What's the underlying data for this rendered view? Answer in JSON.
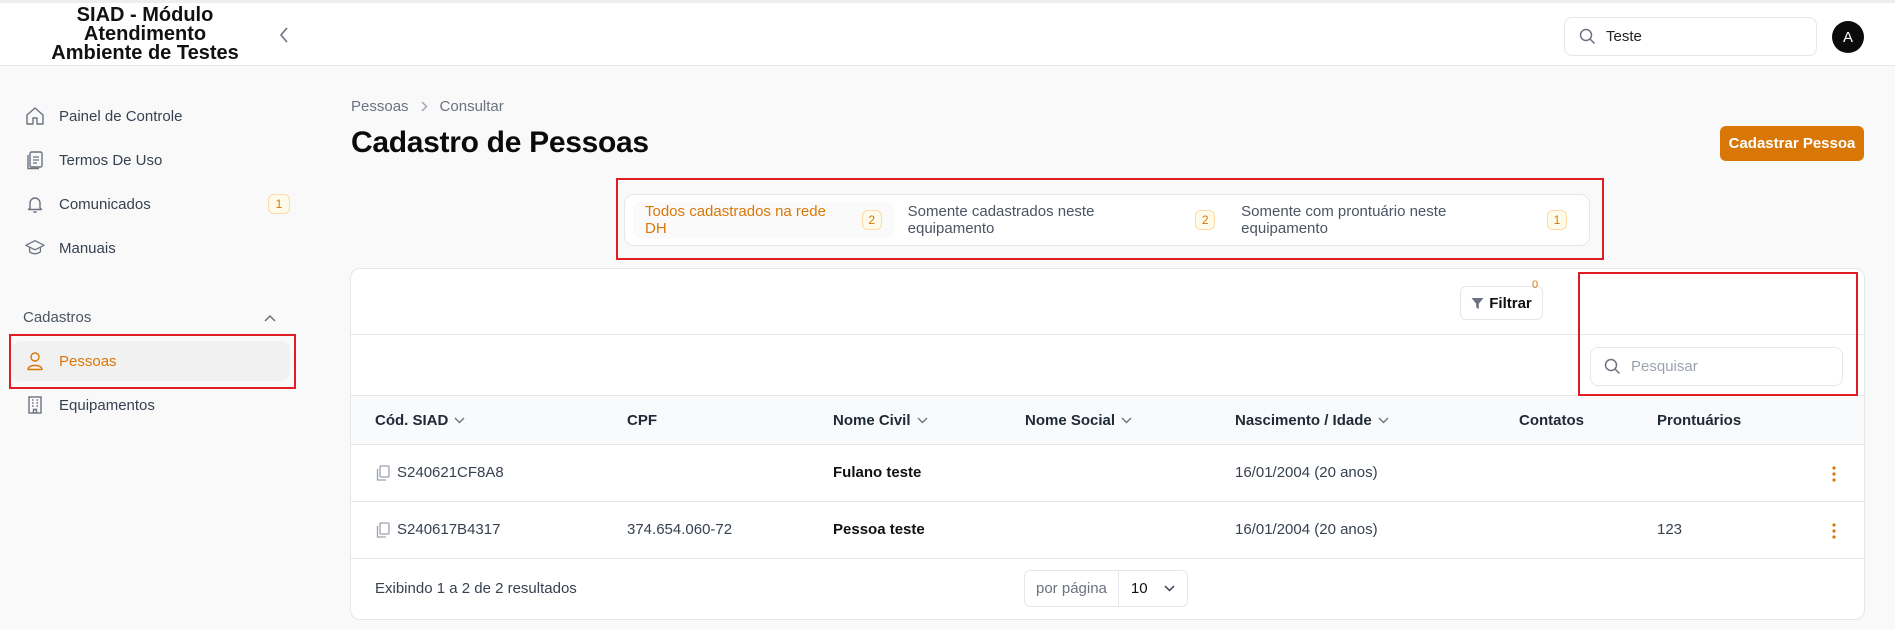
{
  "header": {
    "app_title": "SIAD - Módulo Atendimento Ambiente de Testes",
    "search_value": "Teste",
    "avatar_initial": "A"
  },
  "sidebar": {
    "items": [
      {
        "label": "Painel de Controle",
        "icon": "home-icon"
      },
      {
        "label": "Termos De Uso",
        "icon": "document-icon"
      },
      {
        "label": "Comunicados",
        "icon": "bell-icon",
        "badge": "1"
      },
      {
        "label": "Manuais",
        "icon": "graduation-cap-icon"
      }
    ],
    "section_label": "Cadastros",
    "section_items": [
      {
        "label": "Pessoas",
        "icon": "user-icon",
        "active": true
      },
      {
        "label": "Equipamentos",
        "icon": "building-icon"
      }
    ]
  },
  "breadcrumb": [
    "Pessoas",
    "Consultar"
  ],
  "page_title": "Cadastro de Pessoas",
  "primary_button": "Cadastrar Pessoa",
  "tabs": [
    {
      "label": "Todos cadastrados na rede DH",
      "count": "2",
      "active": true
    },
    {
      "label": "Somente cadastrados neste equipamento",
      "count": "2"
    },
    {
      "label": "Somente com prontuário neste equipamento",
      "count": "1"
    }
  ],
  "toolbar": {
    "filter_label": "Filtrar",
    "filter_count": "0",
    "search_placeholder": "Pesquisar"
  },
  "table": {
    "columns": [
      "Cód. SIAD",
      "CPF",
      "Nome Civil",
      "Nome Social",
      "Nascimento / Idade",
      "Contatos",
      "Prontuários"
    ],
    "rows": [
      {
        "cod": "S240621CF8A8",
        "cpf": "",
        "nome_civil": "Fulano teste",
        "nome_social": "",
        "nascimento": "16/01/2004 (20 anos)",
        "contatos": "",
        "prontuarios": ""
      },
      {
        "cod": "S240617B4317",
        "cpf": "374.654.060-72",
        "nome_civil": "Pessoa teste",
        "nome_social": "",
        "nascimento": "16/01/2004 (20 anos)",
        "contatos": "",
        "prontuarios": "123"
      }
    ]
  },
  "footer": {
    "results_text": "Exibindo 1 a 2 de 2 resultados",
    "per_page_label": "por página",
    "per_page_value": "10"
  },
  "colors": {
    "accent": "#d97706",
    "highlight_box": "#e11d24"
  }
}
